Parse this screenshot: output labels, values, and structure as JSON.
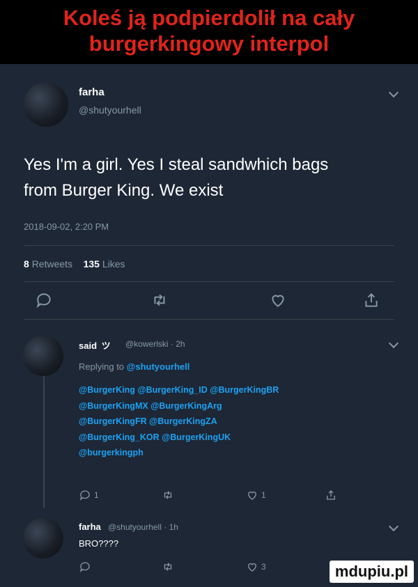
{
  "caption": {
    "line1": "Koleś ją podpierdolił na cały",
    "line2": "burgerkingowy interpol"
  },
  "main_tweet": {
    "name": "farha",
    "handle": "@shutyourhell",
    "text_line1": "Yes I'm a girl. Yes I steal sandwhich bags",
    "text_line2": "from Burger King. We exist",
    "timestamp": "2018-09-02, 2:20 PM",
    "retweets_count": "8",
    "retweets_label": "Retweets",
    "likes_count": "135",
    "likes_label": "Likes"
  },
  "reply_1": {
    "name": "said",
    "badge": "ツ",
    "handle": "@kowerlski",
    "time": "· 2h",
    "replying_prefix": "Replying to",
    "replying_handle": "@shutyourhell",
    "mentions": [
      "@BurgerKing @BurgerKing_ID @BurgerKingBR",
      "@BurgerKingMX @BurgerKingArg",
      "@BurgerKingFR @BurgerKingZA",
      "@BurgerKing_KOR @BurgerKingUK",
      "@burgerkingph"
    ],
    "reply_count": "1",
    "like_count": "1"
  },
  "reply_2": {
    "name": "farha",
    "handle": "@shutyourhell",
    "time": "· 1h",
    "text": "BRO????",
    "like_count": "3"
  },
  "watermark": "mdupiu.pl",
  "icons": [
    "chevron-down-icon",
    "reply-icon",
    "retweet-icon",
    "like-icon",
    "share-icon"
  ],
  "colors": {
    "background": "#1d2735",
    "caption_text": "#e0241b",
    "mention": "#1da1f2",
    "muted": "#8899a6"
  }
}
